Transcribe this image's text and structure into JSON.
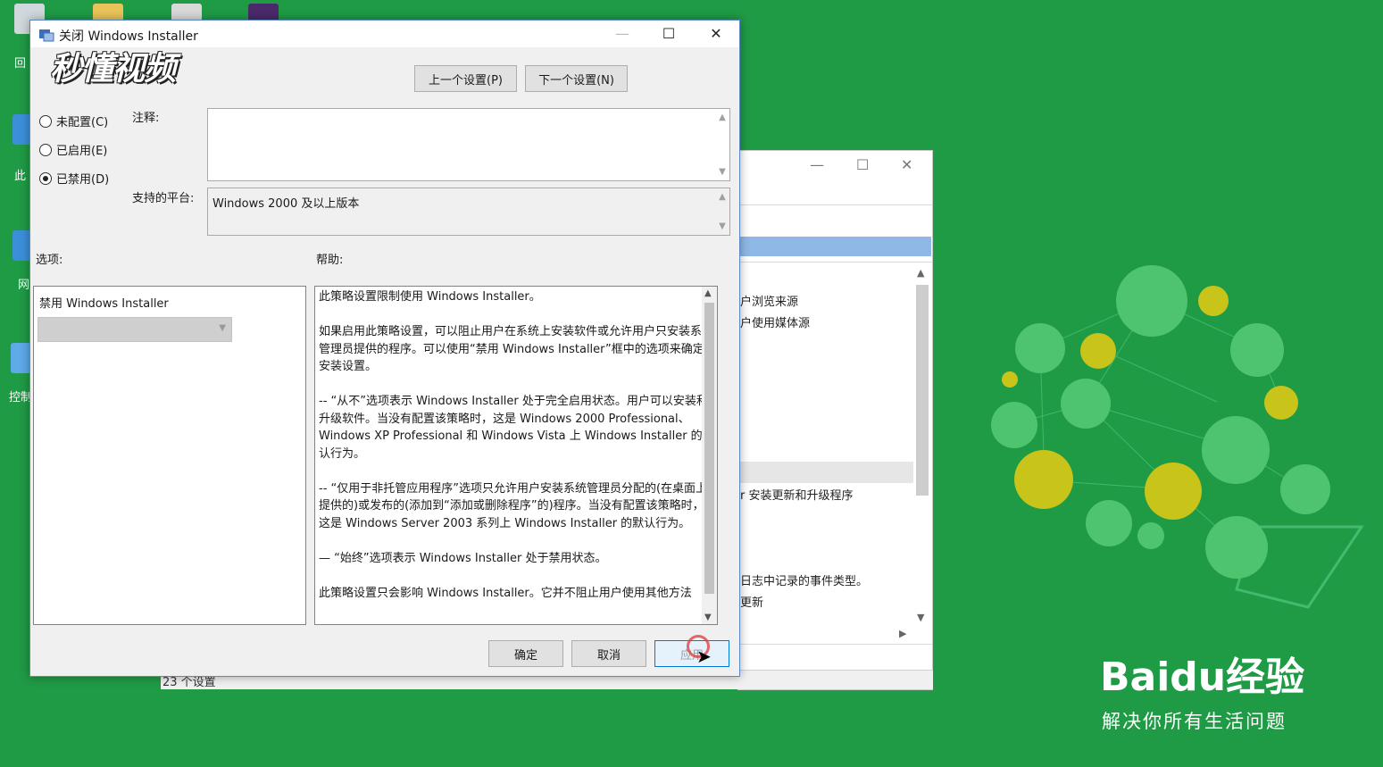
{
  "dialog": {
    "title": "关闭 Windows Installer",
    "prev_setting": "上一个设置(P)",
    "next_setting": "下一个设置(N)",
    "radio_not_configured": "未配置(C)",
    "radio_enabled": "已启用(E)",
    "radio_disabled": "已禁用(D)",
    "selected_state": "disabled",
    "comment_label": "注释:",
    "platform_label": "支持的平台:",
    "platform_value": "Windows 2000 及以上版本",
    "options_label": "选项:",
    "help_label": "帮助:",
    "option_item": "禁用 Windows Installer",
    "help_paragraphs": [
      "此策略设置限制使用 Windows Installer。",
      "如果启用此策略设置，可以阻止用户在系统上安装软件或允许用户只安装系统管理员提供的程序。可以使用“禁用 Windows Installer”框中的选项来确定安装设置。",
      "-- “从不”选项表示 Windows Installer 处于完全启用状态。用户可以安装和升级软件。当没有配置该策略时，这是 Windows 2000 Professional、Windows XP Professional 和 Windows Vista 上 Windows Installer 的默认行为。",
      "-- “仅用于非托管应用程序”选项只允许用户安装系统管理员分配的(在桌面上提供的)或发布的(添加到“添加或删除程序”的)程序。当没有配置该策略时，这是 Windows Server 2003 系列上 Windows Installer 的默认行为。",
      "— “始终”选项表示 Windows Installer 处于禁用状态。",
      "此策略设置只会影响 Windows Installer。它并不阻止用户使用其他方法"
    ],
    "ok": "确定",
    "cancel": "取消",
    "apply": "应用"
  },
  "background_window": {
    "items": [
      "户浏览来源",
      "户使用媒体源",
      "r 安装更新和升级程序",
      "日志中记录的事件类型。",
      "更新"
    ]
  },
  "status_bar": {
    "text": "23 个设置"
  },
  "desktop_labels": [
    "回",
    "此",
    "网",
    "控制"
  ],
  "watermark": {
    "video_logo": "秒懂视频",
    "baidu_brand": "Baidu经验",
    "baidu_slogan": "解决你所有生活问题"
  },
  "colors": {
    "desktop": "#1f9a45",
    "accent": "#0078d7",
    "decor_yellow": "#c8c419"
  }
}
